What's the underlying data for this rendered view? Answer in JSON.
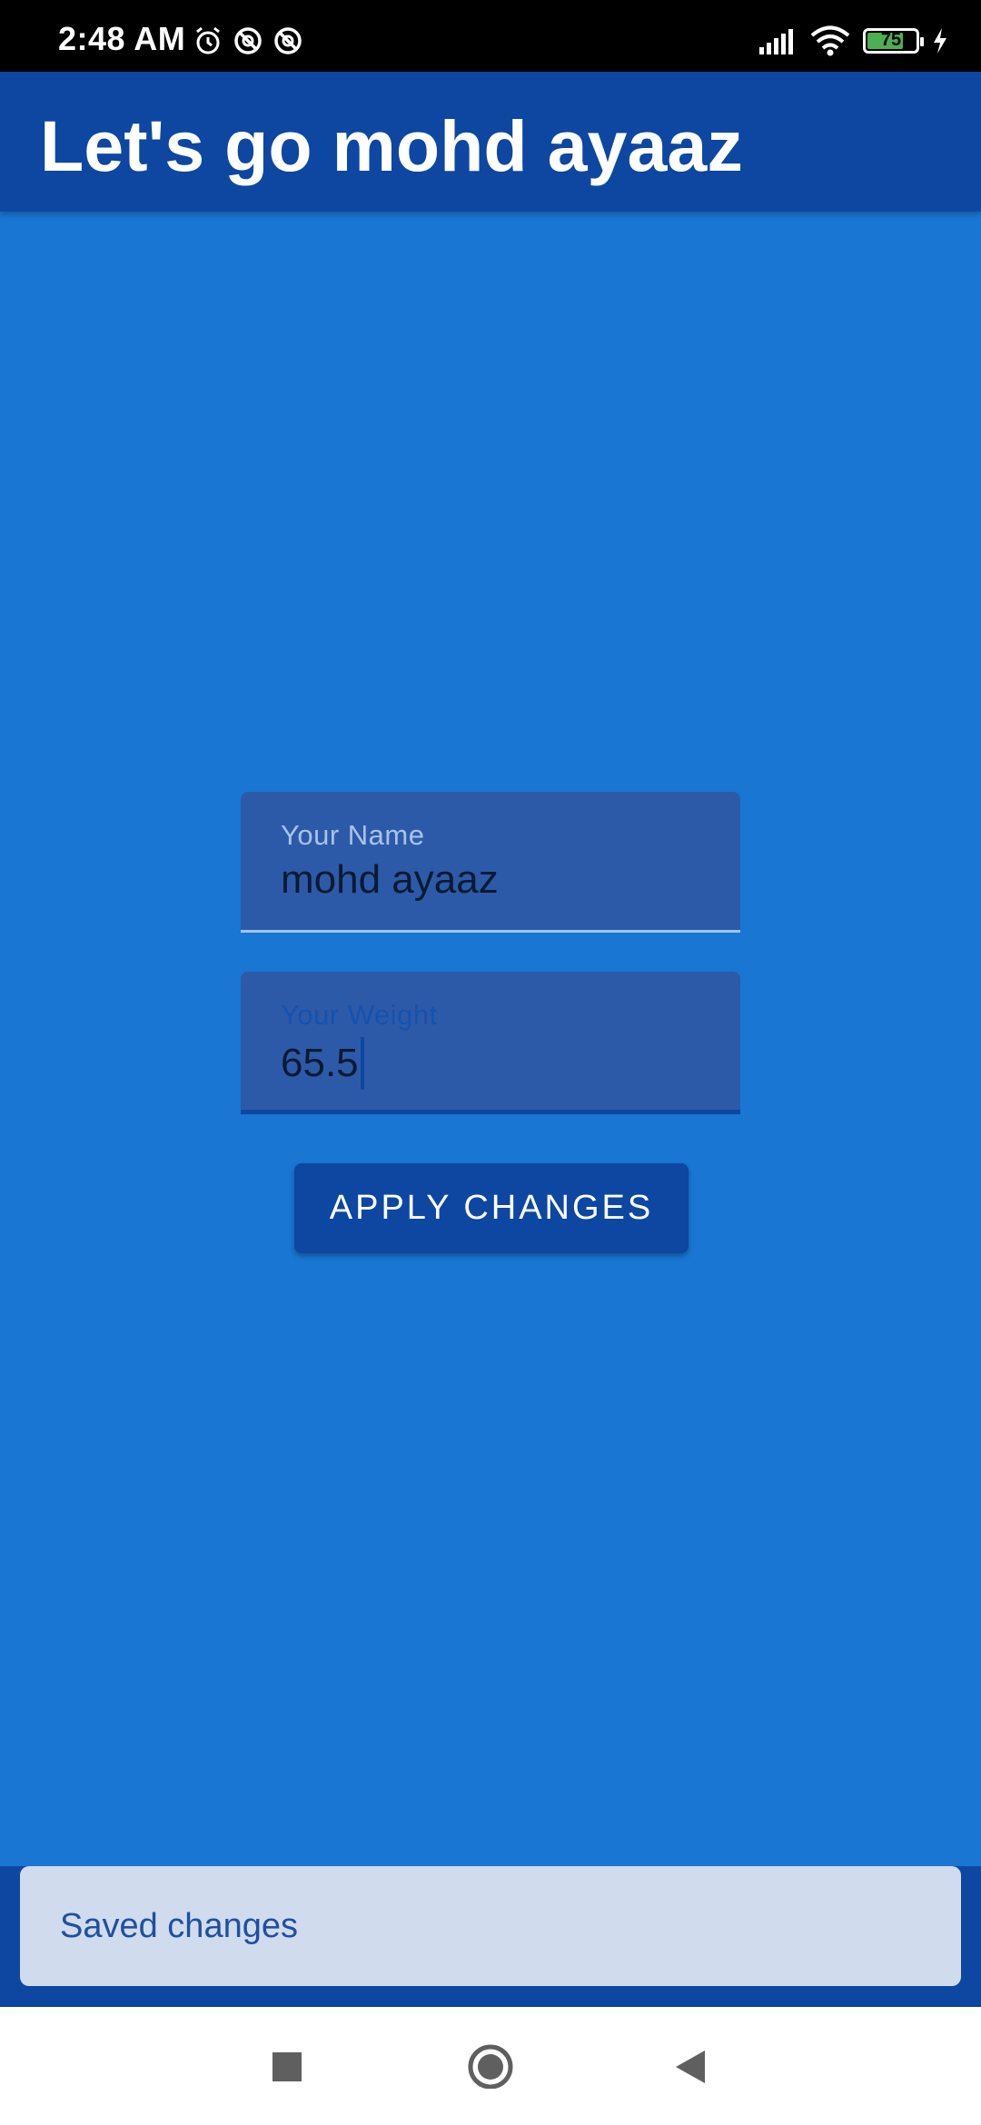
{
  "status_bar": {
    "time": "2:48 AM",
    "battery_level": "75",
    "battery_fraction": 0.75,
    "icons": [
      "alarm-icon",
      "sync-disabled-icon",
      "sync-disabled-icon",
      "signal-icon",
      "wifi-icon",
      "battery-icon",
      "charging-icon"
    ]
  },
  "app_bar": {
    "title": "Let's go mohd ayaaz"
  },
  "form": {
    "name": {
      "label": "Your Name",
      "value": "mohd ayaaz"
    },
    "weight": {
      "label": "Your Weight",
      "value": "65.5"
    },
    "apply_label": "APPLY CHANGES"
  },
  "snackbar": {
    "message": "Saved changes"
  },
  "nav": {
    "icons": [
      "recents-square-icon",
      "home-circle-icon",
      "back-triangle-icon"
    ]
  },
  "colors": {
    "primary": "#1976d2",
    "primary_dark": "#0d47a1",
    "field_bg": "#2d5aa8",
    "snackbar_bg": "#d0dbed"
  }
}
